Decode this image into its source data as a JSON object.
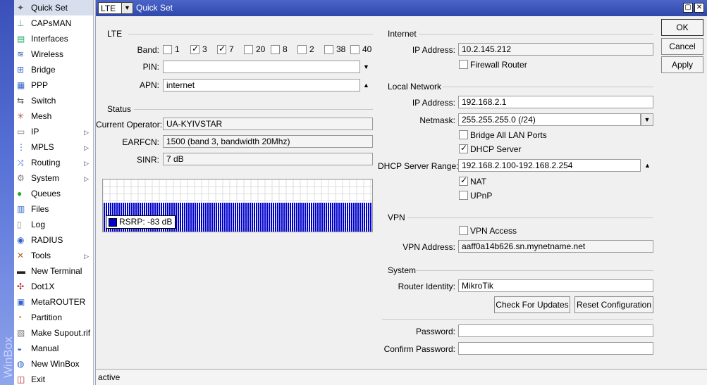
{
  "brand": "WinBox",
  "menu": [
    {
      "label": "Quick Set",
      "icon": "wand-icon",
      "active": true,
      "sub": false
    },
    {
      "label": "CAPsMAN",
      "icon": "capsman-icon",
      "sub": false
    },
    {
      "label": "Interfaces",
      "icon": "interfaces-icon",
      "sub": false
    },
    {
      "label": "Wireless",
      "icon": "wireless-icon",
      "sub": false
    },
    {
      "label": "Bridge",
      "icon": "bridge-icon",
      "sub": false
    },
    {
      "label": "PPP",
      "icon": "ppp-icon",
      "sub": false
    },
    {
      "label": "Switch",
      "icon": "switch-icon",
      "sub": false
    },
    {
      "label": "Mesh",
      "icon": "mesh-icon",
      "sub": false
    },
    {
      "label": "IP",
      "icon": "ip-icon",
      "sub": true
    },
    {
      "label": "MPLS",
      "icon": "mpls-icon",
      "sub": true
    },
    {
      "label": "Routing",
      "icon": "routing-icon",
      "sub": true
    },
    {
      "label": "System",
      "icon": "system-gear-icon",
      "sub": true
    },
    {
      "label": "Queues",
      "icon": "queues-icon",
      "sub": false
    },
    {
      "label": "Files",
      "icon": "files-icon",
      "sub": false
    },
    {
      "label": "Log",
      "icon": "log-icon",
      "sub": false
    },
    {
      "label": "RADIUS",
      "icon": "radius-icon",
      "sub": false
    },
    {
      "label": "Tools",
      "icon": "tools-icon",
      "sub": true
    },
    {
      "label": "New Terminal",
      "icon": "terminal-icon",
      "sub": false
    },
    {
      "label": "Dot1X",
      "icon": "dot1x-icon",
      "sub": false
    },
    {
      "label": "MetaROUTER",
      "icon": "metarouter-icon",
      "sub": false
    },
    {
      "label": "Partition",
      "icon": "partition-icon",
      "sub": false
    },
    {
      "label": "Make Supout.rif",
      "icon": "supout-icon",
      "sub": false
    },
    {
      "label": "Manual",
      "icon": "manual-icon",
      "sub": false
    },
    {
      "label": "New WinBox",
      "icon": "winbox-icon",
      "sub": false
    },
    {
      "label": "Exit",
      "icon": "exit-icon",
      "sub": false
    }
  ],
  "window": {
    "mode": "LTE",
    "title": "Quick Set"
  },
  "buttons": {
    "ok": "OK",
    "cancel": "Cancel",
    "apply": "Apply",
    "check_updates": "Check For Updates",
    "reset_config": "Reset Configuration"
  },
  "lte": {
    "title": "LTE",
    "band_label": "Band:",
    "bands": [
      {
        "label": "1",
        "checked": false
      },
      {
        "label": "3",
        "checked": true
      },
      {
        "label": "7",
        "checked": true
      },
      {
        "label": "20",
        "checked": false
      },
      {
        "label": "8",
        "checked": false
      },
      {
        "label": "2",
        "checked": false
      },
      {
        "label": "38",
        "checked": false
      },
      {
        "label": "40",
        "checked": false
      }
    ],
    "pin_label": "PIN:",
    "pin_value": "",
    "apn_label": "APN:",
    "apn_value": "internet"
  },
  "status": {
    "title": "Status",
    "operator_label": "Current Operator:",
    "operator_value": "UA-KYIVSTAR",
    "earfcn_label": "EARFCN:",
    "earfcn_value": "1500 (band 3, bandwidth 20Mhz)",
    "sinr_label": "SINR:",
    "sinr_value": "7 dB",
    "rsrp_legend": "RSRP:  -83 dB",
    "rsrp_color": "#0000cc"
  },
  "internet": {
    "title": "Internet",
    "ip_label": "IP Address:",
    "ip_value": "10.2.145.212",
    "firewall_label": "Firewall Router",
    "firewall_checked": false
  },
  "local": {
    "title": "Local Network",
    "ip_label": "IP Address:",
    "ip_value": "192.168.2.1",
    "netmask_label": "Netmask:",
    "netmask_value": "255.255.255.0 (/24)",
    "bridge_label": "Bridge All LAN Ports",
    "bridge_checked": false,
    "dhcp_label": "DHCP Server",
    "dhcp_checked": true,
    "range_label": "DHCP Server Range:",
    "range_value": "192.168.2.100-192.168.2.254",
    "nat_label": "NAT",
    "nat_checked": true,
    "upnp_label": "UPnP",
    "upnp_checked": false
  },
  "vpn": {
    "title": "VPN",
    "access_label": "VPN Access",
    "access_checked": false,
    "address_label": "VPN Address:",
    "address_value": "aaff0a14b626.sn.mynetname.net"
  },
  "system": {
    "title": "System",
    "identity_label": "Router Identity:",
    "identity_value": "MikroTik",
    "password_label": "Password:",
    "password_value": "",
    "confirm_label": "Confirm Password:",
    "confirm_value": ""
  },
  "statusbar": {
    "text": "active"
  }
}
